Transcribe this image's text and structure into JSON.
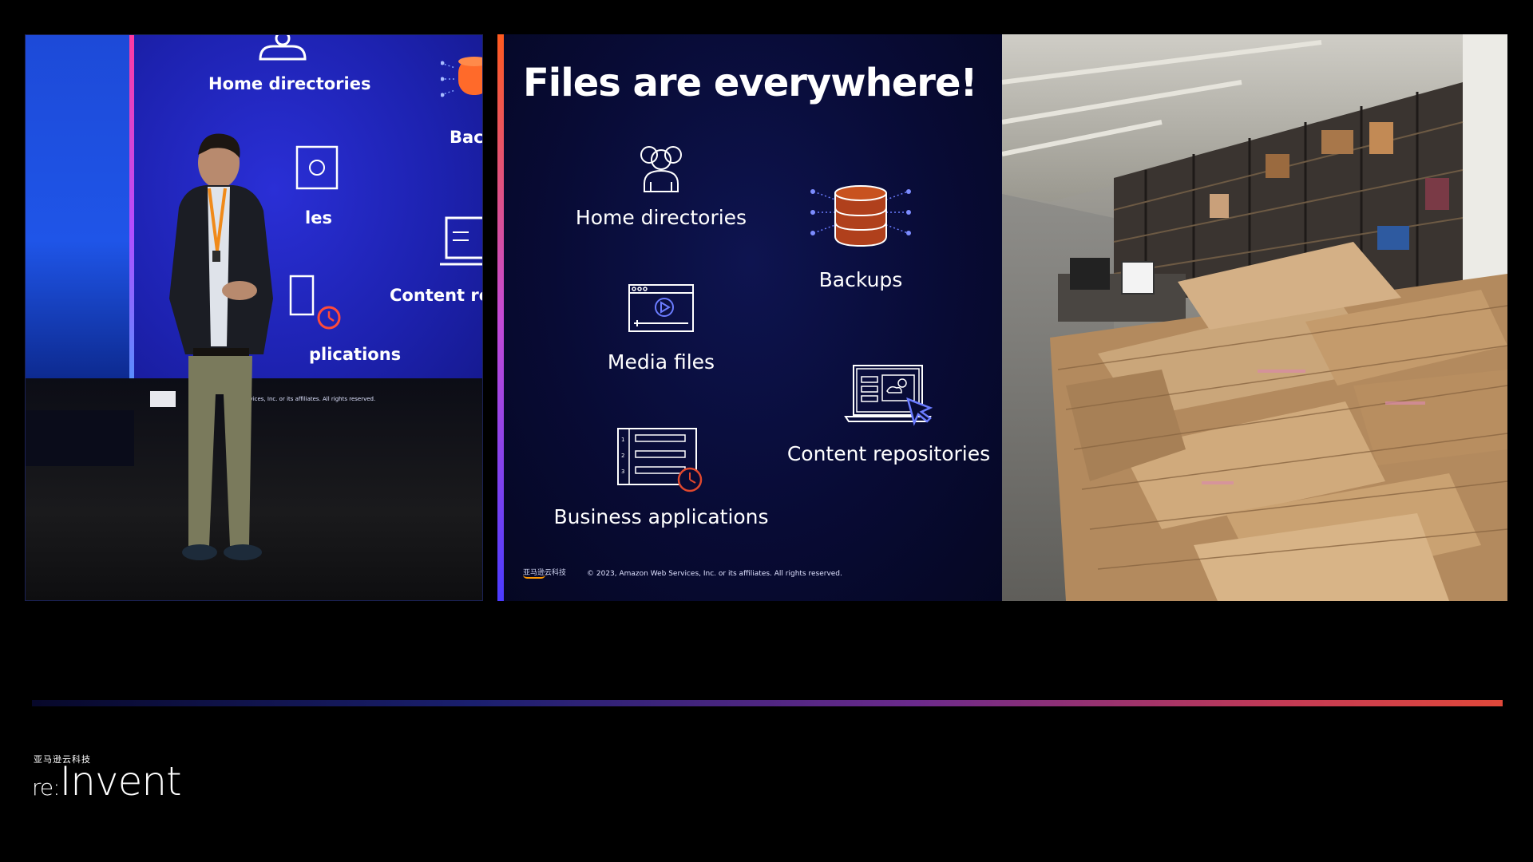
{
  "camera_panel": {
    "screen_labels": {
      "home": "Home directories",
      "backups_partial": "Bacl",
      "media_partial": "les",
      "content_partial": "Content re",
      "apps_partial": "plications"
    },
    "screen_copyright": "1, A   Services, Inc. or its affiliates. All rights reserved."
  },
  "slide": {
    "title": "Files are everywhere!",
    "items": {
      "home": "Home directories",
      "backups": "Backups",
      "media": "Media files",
      "content": "Content repositories",
      "business": "Business applications"
    },
    "footer_logo": "亚马逊云科技",
    "copyright": "© 2023, Amazon Web Services, Inc. or its affiliates. All rights reserved."
  },
  "branding": {
    "chinese": "亚马逊云科技",
    "logo_re": "re:",
    "logo_invent": "Invent"
  },
  "colors": {
    "slide_bg": "#080b35",
    "accent_blue": "#4b5cff",
    "backup_red": "#b0401c",
    "clock_red": "#e0482e"
  }
}
